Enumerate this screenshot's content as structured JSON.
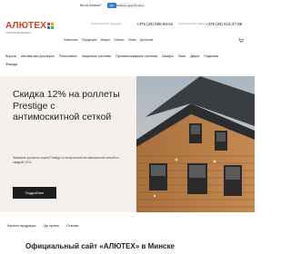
{
  "city_popup": {
    "question": "Вы из Минска?",
    "yes_label": "Да",
    "other_label": "Выбрать другой город"
  },
  "header": {
    "logo_text": "АЛЮТЕХ",
    "logo_colors": [
      "#e03a2b",
      "#f2a500",
      "#2b7bd8",
      "#4caf50"
    ],
    "logo_sub": "в Республике Беларусь",
    "label_left": "Консультация по продукции",
    "phone_left": "+375 (29) 680-59-64",
    "label_right": "Консультация по заказу",
    "phone_right": "+375 (29) 613-37-88",
    "menu": [
      "Компания",
      "Продукция",
      "Медиа",
      "Сервис",
      "Связь",
      "Дилерам"
    ]
  },
  "nav": {
    "items": [
      "Ворота",
      "Автоматика для ворот",
      "Рольставни",
      "Защитные системы",
      "Противопожарные системы",
      "Шкафы",
      "Окна",
      "Двери",
      "Подъемы"
    ],
    "second_line": "Фасады"
  },
  "hero": {
    "title": "Скидка 12% на роллеты Prestige с антимоскитной сеткой",
    "description": "Закажите роллеты серии Prestige со встроенной антимоскитной сеткой со скидкой 12%.",
    "button_label": "Подробнее"
  },
  "links": [
    "Каталог продукции",
    "Где купить",
    "Отзывы"
  ],
  "section_heading": "Официальный сайт «АЛЮТЕХ» в Минске"
}
